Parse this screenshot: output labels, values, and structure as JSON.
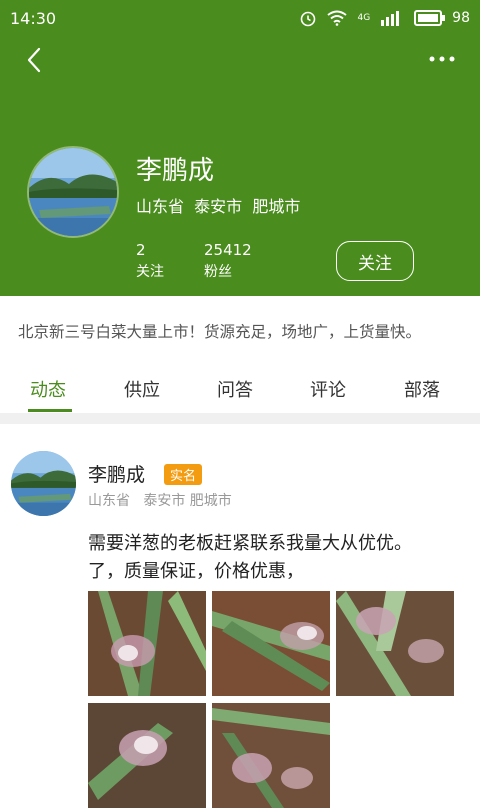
{
  "status_bar": {
    "time": "14:30",
    "network": "4G",
    "battery": "98",
    "battery_level": 0.98
  },
  "header": {
    "back_icon": "chevron-left-icon",
    "more_icon": "more-horizontal-icon"
  },
  "profile": {
    "name": "李鹏成",
    "location": "山东省  泰安市  肥城市",
    "following_count": "2",
    "following_label": "关注",
    "fans_count": "25412",
    "fans_label": "粉丝",
    "follow_button": "关注"
  },
  "intro": "北京新三号白菜大量上市！货源充足，场地广，上货量快。",
  "tabs": [
    {
      "label": "动态",
      "active": true
    },
    {
      "label": "供应"
    },
    {
      "label": "问答"
    },
    {
      "label": "评论"
    },
    {
      "label": "部落"
    }
  ],
  "post": {
    "author": "李鹏成",
    "badge": "实名",
    "location": "山东省   泰安市 肥城市",
    "text_lines": [
      "需要洋葱的老板赶紧联系我量大从优优。",
      "了，质量保证，价格优惠，"
    ],
    "photos": 5
  },
  "colors": {
    "brand_green": "#4a8c1d",
    "badge_orange": "#f39c12",
    "divider": "#f0f0f0"
  }
}
